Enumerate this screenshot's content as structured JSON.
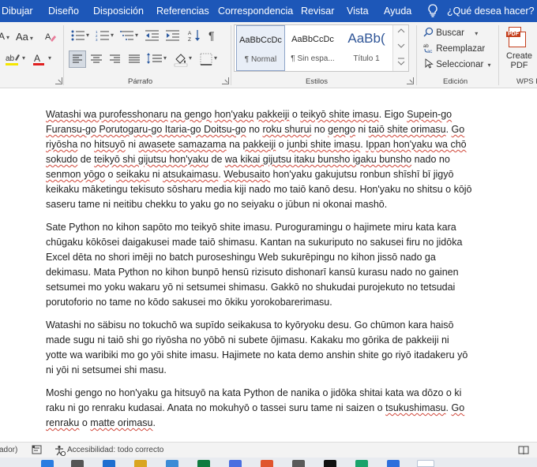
{
  "menu": {
    "tabs": [
      "Dibujar",
      "Diseño",
      "Disposición",
      "Referencias",
      "Correspondencia",
      "Revisar",
      "Vista",
      "Ayuda"
    ],
    "help_placeholder": "¿Qué desea hacer?"
  },
  "ribbon": {
    "font_size_label": "Aa",
    "groups": {
      "paragraph": "Párrafo",
      "styles": "Estilos",
      "editing": "Edición",
      "wps": "WPS P"
    },
    "styles": [
      {
        "sample": "AaBbCcDc",
        "name": "¶ Normal",
        "selected": true
      },
      {
        "sample": "AaBbCcDc",
        "name": "¶ Sin espa...",
        "selected": false
      },
      {
        "sample": "AaBb(",
        "name": "Título 1",
        "selected": false
      }
    ],
    "editing": {
      "find": "Buscar",
      "replace": "Reemplazar",
      "select": "Seleccionar"
    },
    "pdf": {
      "tag": "PDF",
      "line1": "Create",
      "line2": "PDF"
    }
  },
  "document": {
    "paragraphs": [
      [
        {
          "t": "Watashi wa purofesshonaru",
          "s": true
        },
        {
          "t": " "
        },
        {
          "t": "na gengo",
          "s": true
        },
        {
          "t": " "
        },
        {
          "t": "hon'yaku",
          "s": true
        },
        {
          "t": " "
        },
        {
          "t": "pakkeiji",
          "s": true
        },
        {
          "t": " o "
        },
        {
          "t": "teikyō shite imasu",
          "s": true
        },
        {
          "t": ". Eigo "
        },
        {
          "t": "Supein-go Furansu-go Porutogaru-go Itaria-go Doitsu-go",
          "s": true
        },
        {
          "t": " no "
        },
        {
          "t": "roku shurui",
          "s": true
        },
        {
          "t": " no "
        },
        {
          "t": "gengo",
          "s": true
        },
        {
          "t": " ni "
        },
        {
          "t": "taiō shite orimasu",
          "s": true
        },
        {
          "t": ". "
        },
        {
          "t": "Go riyōsha",
          "s": true
        },
        {
          "t": " no "
        },
        {
          "t": "hitsuyō",
          "s": true
        },
        {
          "t": " ni "
        },
        {
          "t": "awasete samazama",
          "s": true
        },
        {
          "t": " na "
        },
        {
          "t": "pakkeiji",
          "s": true
        },
        {
          "t": " o "
        },
        {
          "t": "junbi shite imasu",
          "s": true
        },
        {
          "t": ". "
        },
        {
          "t": "Ippan hon'yaku wa chō sokudo",
          "s": true
        },
        {
          "t": " de "
        },
        {
          "t": "teikyō shi gijutsu hon'yaku",
          "s": true
        },
        {
          "t": " de "
        },
        {
          "t": "wa kikai gijutsu itaku bunsho igaku bunsho",
          "s": true
        },
        {
          "t": " nado no "
        },
        {
          "t": "senmon yōgo",
          "s": true
        },
        {
          "t": " o "
        },
        {
          "t": "seikaku",
          "s": true
        },
        {
          "t": " ni "
        },
        {
          "t": "atsukaimasu",
          "s": true
        },
        {
          "t": ". "
        },
        {
          "t": "Webusaito",
          "s": true
        },
        {
          "t": " hon'yaku gakujutsu ronbun shīshī bī jigyō keikaku māketingu tekisuto sōsharu media kiji nado mo taiō kanō desu. Hon'yaku no shitsu o kōjō saseru tame ni neitibu chekku to yaku go no seiyaku o jūbun ni okonai mashō."
        }
      ],
      [
        {
          "t": "Sate Python no kihon sapōto mo teikyō shite imasu. Puroguramingu o hajimete miru kata kara chūgaku kōkōsei daigakusei made taiō shimasu. Kantan na sukuriputo no sakusei firu no jidōka Excel dēta no shori imēji no batch puroseshingu Web sukurēpingu no kihon jissō nado ga dekimasu. Mata Python no kihon bunpō hensū rizisuto dishonarī kansū kurasu nado no gainen setsumei mo yoku wakaru yō ni setsumei shimasu. Gakkō no shukudai purojekuto no tetsudai porutoforio no tame no kōdo sakusei mo ōkiku yorokobarerimasu."
        }
      ],
      [
        {
          "t": "Watashi no säbisu no tokuchō wa supīdo seikakusa to kyōryoku desu. Go chūmon kara haisō made sugu ni taiō shi go riyōsha no yōbō ni subete ōjimasu. Kakaku mo gōrika de pakkeiji ni yotte wa waribiki mo go yōi shite imasu. Hajimete no kata demo anshin shite go riyō itadakeru yō ni yōi ni setsumei shi masu."
        }
      ],
      [
        {
          "t": "Moshi gengo no hon'yaku ga hitsuyō na kata Python de nanika o jidōka shitai kata wa dōzo o ki raku ni go renraku kudasai. Anata no mokuhyō o tassei suru tame ni saizen o "
        },
        {
          "t": "tsukushimasu",
          "s": true
        },
        {
          "t": ". "
        },
        {
          "t": "Go renraku",
          "s": true
        },
        {
          "t": " o "
        },
        {
          "t": "matte orimasu",
          "s": true
        },
        {
          "t": "."
        }
      ]
    ]
  },
  "status": {
    "left_fragment": "ador)",
    "accessibility": "Accesibilidad: todo correcto"
  },
  "colors": {
    "menubar": "#1d57b8",
    "font_color_red": "#e02020",
    "highlight_yellow": "#f5e600",
    "squiggle": "#d0473a"
  }
}
